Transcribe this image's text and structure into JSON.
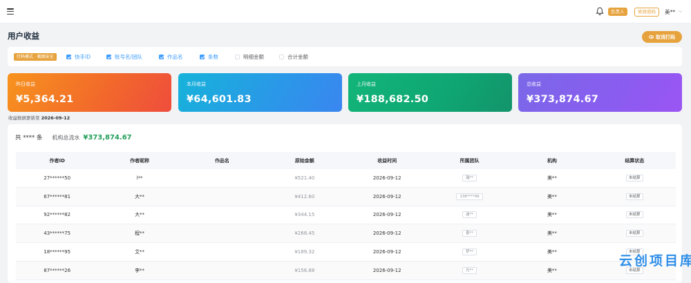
{
  "topbar": {
    "role_badge": "负责人",
    "change_password": "修改密码",
    "user_name": "美**",
    "user_caret": "⌵"
  },
  "page": {
    "title": "用户收益",
    "cancel_print": "取消打码"
  },
  "filters": {
    "mode_tag": "打码模式 · 截图安全",
    "options": [
      {
        "label": "快手ID",
        "checked": true
      },
      {
        "label": "账号名/团队",
        "checked": true
      },
      {
        "label": "作品名",
        "checked": true
      },
      {
        "label": "条数",
        "checked": true
      },
      {
        "label": "明细金额",
        "checked": false
      },
      {
        "label": "合计金额",
        "checked": false
      }
    ]
  },
  "cards": [
    {
      "label": "昨日收益",
      "value": "¥5,364.21"
    },
    {
      "label": "本月收益",
      "value": "¥64,601.83"
    },
    {
      "label": "上月收益",
      "value": "¥188,682.50"
    },
    {
      "label": "总收益",
      "value": "¥373,874.67"
    }
  ],
  "update_note": {
    "prefix": "收益数据更新至",
    "date": "2026-09-12"
  },
  "summary": {
    "count_text": "共 **** 条",
    "flow_label": "机构总流水",
    "flow_value": "¥373,874.67"
  },
  "table": {
    "headers": [
      "作者ID",
      "作者昵称",
      "作品名",
      "原始金额",
      "收益时间",
      "所属团队",
      "机构",
      "结算状态"
    ],
    "rows": [
      {
        "author_id": "27******50",
        "nickname": "l**",
        "work": "",
        "amount": "¥521.40",
        "time": "2026-09-12",
        "team": "瀚**",
        "org": "美**",
        "status": "未结算"
      },
      {
        "author_id": "67******81",
        "nickname": "大**",
        "work": "",
        "amount": "¥412.60",
        "time": "2026-09-12",
        "team": "138****46",
        "org": "美**",
        "status": "未结算"
      },
      {
        "author_id": "92******82",
        "nickname": "大**",
        "work": "",
        "amount": "¥344.15",
        "time": "2026-09-12",
        "team": "迪**",
        "org": "美**",
        "status": "未结算"
      },
      {
        "author_id": "43******75",
        "nickname": "程**",
        "work": "",
        "amount": "¥268.45",
        "time": "2026-09-12",
        "team": "善**",
        "org": "美**",
        "status": "未结算"
      },
      {
        "author_id": "18******95",
        "nickname": "艾**",
        "work": "",
        "amount": "¥189.32",
        "time": "2026-09-12",
        "team": "梦**",
        "org": "美**",
        "status": "未结算"
      },
      {
        "author_id": "87******26",
        "nickname": "李**",
        "work": "",
        "amount": "¥156.88",
        "time": "2026-09-12",
        "team": "光**",
        "org": "美**",
        "status": "未结算"
      }
    ]
  },
  "watermark": "云创项目库"
}
